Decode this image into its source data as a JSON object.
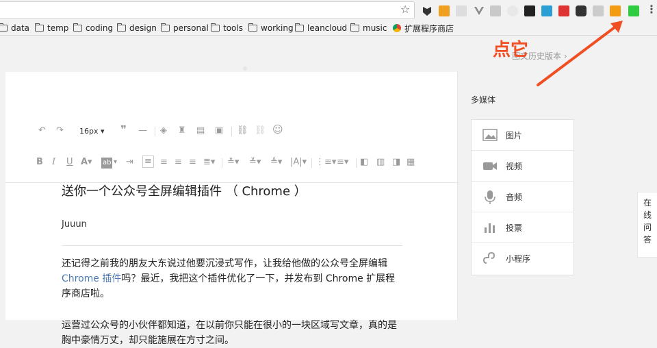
{
  "browser": {
    "bookmarks": [
      "data",
      "temp",
      "coding",
      "design",
      "personal",
      "tools",
      "working",
      "leancloud",
      "music"
    ],
    "webstore_label": "扩展程序商店"
  },
  "header": {
    "history_label": "图文历史版本 ›"
  },
  "toolbar": {
    "font_size": "16px"
  },
  "article": {
    "title": "送你一个公众号全屏编辑插件 （ Chrome ）",
    "author": "Juuun",
    "p1_a": "还记得之前我的朋友大东说过他要沉浸式写作，让我给他做的公众号全屏编辑 ",
    "p1_link": "Chrome 插件",
    "p1_b": "吗？最近，我把这个插件优化了一下，并发布到 Chrome 扩展程序商店啦。",
    "p2": "运营过公众号的小伙伴都知道，在以前你只能在很小的一块区域写文章，真的是胸中豪情万丈，却只能施展在方寸之间。"
  },
  "sidebar": {
    "media_title": "多媒体",
    "items": [
      "图片",
      "视频",
      "音频",
      "投票",
      "小程序"
    ]
  },
  "qa_tab": [
    "在",
    "线",
    "问",
    "答"
  ],
  "annotation": {
    "text": "点它",
    "color": "#f04e23"
  }
}
